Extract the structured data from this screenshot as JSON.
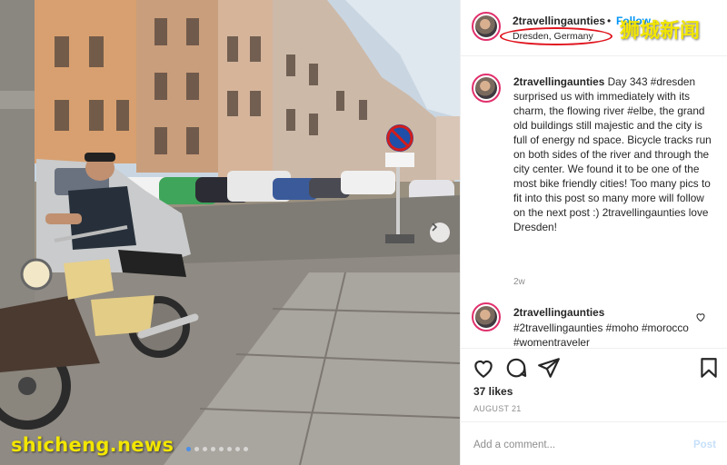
{
  "header": {
    "username": "2travellingaunties",
    "separator": "•",
    "follow_label": "Follow",
    "location": "Dresden, Germany",
    "watermark": "狮城新闻"
  },
  "caption": {
    "username": "2travellingaunties",
    "text": "Day 343 #dresden surprised us with immediately with its charm, the flowing river #elbe, the grand old buildings still majestic and the city is full of energy nd space. Bicycle tracks run on both sides of the river and through the city center. We found it to be one of the most bike friendly cities! Too many pics to fit into this post so many more will follow on the next post :) 2travellingaunties love Dresden!",
    "time": "2w"
  },
  "comment": {
    "username": "2travellingaunties",
    "text": "#2travellingaunties #moho #morocco #womentraveler"
  },
  "actions": {
    "like_icon": "heart-icon",
    "comment_icon": "comment-icon",
    "share_icon": "share-icon",
    "save_icon": "bookmark-icon"
  },
  "likes_label": "37 likes",
  "date_label": "AUGUST 21",
  "add_comment": {
    "placeholder": "Add a comment...",
    "post_label": "Post"
  },
  "carousel": {
    "total_slides": 8,
    "active_slide": 1
  },
  "watermark_bottom": "shicheng.news",
  "colors": {
    "link_blue": "#0095f6",
    "watermark_yellow": "#f2e600",
    "highlight_red": "#e0141e",
    "muted_gray": "#8e8e8e"
  }
}
